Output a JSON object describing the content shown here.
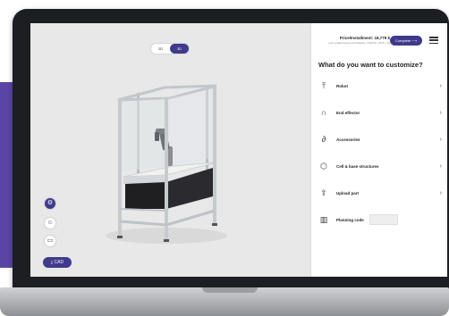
{
  "viewer": {
    "view_toggle": [
      "2D",
      "3D"
    ],
    "active_view": "3D",
    "cad_button_label": "⤓ CAD"
  },
  "panel": {
    "price_text": "Price/Installment: 18,779 $",
    "price_subtext": "excl. guided setup and delivery. 3,500 $ + 99 € / mo",
    "complete_button": "Complete ⟶",
    "heading": "What do you want to customize?",
    "items": [
      {
        "label": "Robot",
        "icon": "robot-arm-icon"
      },
      {
        "label": "End effector",
        "icon": "gripper-icon"
      },
      {
        "label": "Accessories",
        "icon": "paperclip-icon"
      },
      {
        "label": "Cell & base structures",
        "icon": "cube-icon"
      },
      {
        "label": "Upload part",
        "icon": "upload-icon"
      },
      {
        "label": "Planning code",
        "icon": "barcode-icon"
      }
    ]
  },
  "colors": {
    "accent": "#3f3a8c",
    "brand_block": "#5b46a6",
    "viewport_bg": "#e8e8e9"
  }
}
